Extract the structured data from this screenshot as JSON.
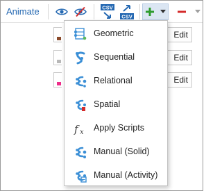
{
  "toolbar": {
    "animate_label": "Animate",
    "csv_import_label": "CSV",
    "csv_export_label": "CSV",
    "colors": {
      "accent": "#2468b2",
      "add": "#2e9c2e",
      "remove": "#d42b2b",
      "hidden": "#d42b2b"
    },
    "icons": [
      "eye-icon",
      "eye-hidden-icon",
      "csv-import-icon",
      "csv-export-icon",
      "plus-icon",
      "dropdown-arrow-icon",
      "minus-icon"
    ]
  },
  "rows": [
    {
      "edit_label": "Edit",
      "marker_color": "#8b4a2b"
    },
    {
      "edit_label": "Edit",
      "marker_color": "#b8b8b8"
    },
    {
      "edit_label": "Edit",
      "marker_color": "#ee2d8a"
    }
  ],
  "menu": {
    "items": [
      {
        "label": "Geometric",
        "icon": "geometric-icon"
      },
      {
        "label": "Sequential",
        "icon": "sequential-icon"
      },
      {
        "label": "Relational",
        "icon": "relational-icon"
      },
      {
        "label": "Spatial",
        "icon": "spatial-icon"
      },
      {
        "label": "Apply Scripts",
        "icon": "fx-icon"
      },
      {
        "label": "Manual (Solid)",
        "icon": "manual-solid-icon"
      },
      {
        "label": "Manual (Activity)",
        "icon": "manual-activity-icon"
      }
    ]
  }
}
